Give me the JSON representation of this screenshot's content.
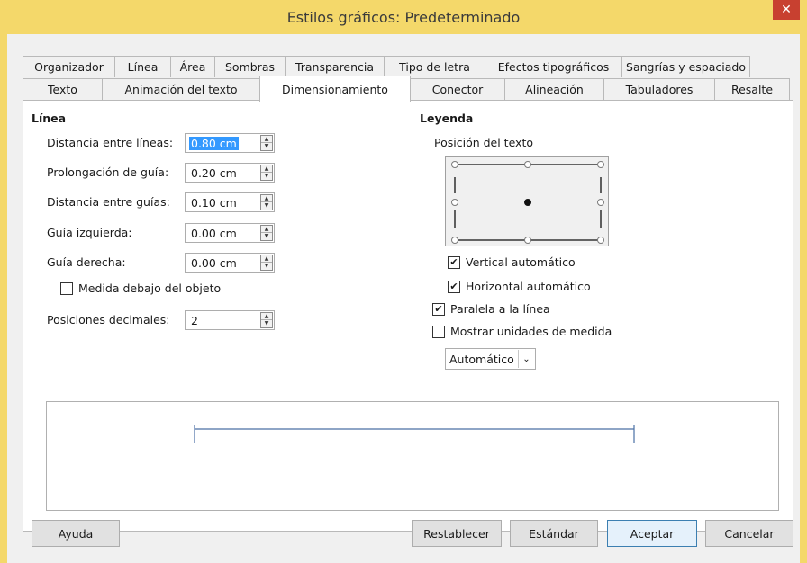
{
  "window": {
    "title": "Estilos gráficos: Predeterminado",
    "close_glyph": "✕"
  },
  "tabs_row1": [
    "Organizador",
    "Línea",
    "Área",
    "Sombras",
    "Transparencia",
    "Tipo de letra",
    "Efectos tipográficos",
    "Sangrías y espaciado"
  ],
  "tabs_row2": [
    "Texto",
    "Animación del texto",
    "Dimensionamiento",
    "Conector",
    "Alineación",
    "Tabuladores",
    "Resalte"
  ],
  "active_tab": "Dimensionamiento",
  "linea": {
    "title": "Línea",
    "fields": [
      {
        "label": "Distancia entre líneas:",
        "value": "0.80 cm"
      },
      {
        "label": "Prolongación de guía:",
        "value": "0.20 cm"
      },
      {
        "label": "Distancia entre guías:",
        "value": "0.10 cm"
      },
      {
        "label": "Guía izquierda:",
        "value": "0.00 cm"
      },
      {
        "label": "Guía derecha:",
        "value": "0.00 cm"
      }
    ],
    "medida_debajo": {
      "label": "Medida debajo del objeto",
      "checked": false
    },
    "posiciones": {
      "label": "Posiciones decimales:",
      "value": "2"
    }
  },
  "leyenda": {
    "title": "Leyenda",
    "posicion_label": "Posición del texto",
    "vertical_auto": {
      "label": "Vertical automático",
      "checked": true
    },
    "horizontal_auto": {
      "label": "Horizontal automático",
      "checked": true
    },
    "paralela": {
      "label": "Paralela a la línea",
      "checked": true
    },
    "mostrar_unidades": {
      "label": "Mostrar unidades de medida",
      "checked": false
    },
    "unidad_select": "Automático"
  },
  "buttons": {
    "help": "Ayuda",
    "reset": "Restablecer",
    "standard": "Estándar",
    "ok": "Aceptar",
    "cancel": "Cancelar"
  },
  "colors": {
    "titlebar": "#f4d86a",
    "close": "#c84030",
    "selection": "#3399ff",
    "dimension_line": "#4a6fa5"
  }
}
